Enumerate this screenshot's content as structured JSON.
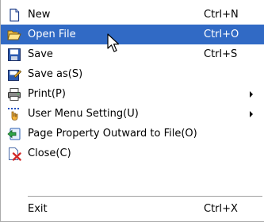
{
  "menu": {
    "items": [
      {
        "label": "New",
        "shortcut": "Ctrl+N",
        "icon": "new-file-icon"
      },
      {
        "label": "Open File",
        "shortcut": "Ctrl+O",
        "icon": "open-folder-icon",
        "state": "highlighted"
      },
      {
        "label": "Save",
        "shortcut": "Ctrl+S",
        "icon": "save-disk-icon"
      },
      {
        "label": "Save as(S)",
        "icon": "save-as-icon"
      },
      {
        "label": "Print(P)",
        "icon": "printer-icon",
        "has_submenu": true
      },
      {
        "label": "User Menu Setting(U)",
        "icon": "user-menu-setting-icon",
        "has_submenu": true
      },
      {
        "label": "Page Property Outward to File(O)",
        "icon": "export-property-icon"
      },
      {
        "label": "Close(C)",
        "icon": "close-document-icon"
      },
      {
        "label": "Exit",
        "shortcut": "Ctrl+X",
        "separator_before": true
      }
    ],
    "highlight_color": "#316ac5",
    "highlight_text_color": "#ffffff",
    "text_color": "#000000",
    "border_color": "#ababab"
  }
}
